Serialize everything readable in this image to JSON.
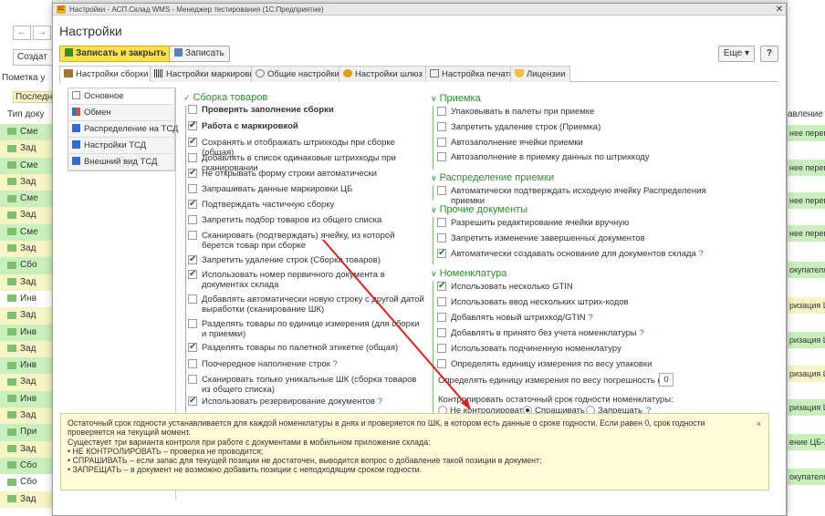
{
  "bg": {
    "create_label": "Создат",
    "mark_label": "Пометка у",
    "last_label": "Последн",
    "type_col": "Тип доку",
    "rows": [
      {
        "text": "Сме",
        "c": "g"
      },
      {
        "text": "Зад",
        "c": "y"
      },
      {
        "text": "Сме",
        "c": "g"
      },
      {
        "text": "Зад",
        "c": "y"
      },
      {
        "text": "Сме",
        "c": "g"
      },
      {
        "text": "Зад",
        "c": "y"
      },
      {
        "text": "Сме",
        "c": "g"
      },
      {
        "text": "Зад",
        "c": "y"
      },
      {
        "text": "Сбо",
        "c": "g"
      },
      {
        "text": "Зад",
        "c": "y"
      },
      {
        "text": "Инв",
        "c": "w"
      },
      {
        "text": "Зад",
        "c": "y"
      },
      {
        "text": "Инв",
        "c": "g"
      },
      {
        "text": "Зад",
        "c": "y"
      },
      {
        "text": "Инв",
        "c": "g"
      },
      {
        "text": "Зад",
        "c": "y"
      },
      {
        "text": "Инв",
        "c": "g"
      },
      {
        "text": "Зад",
        "c": "y"
      },
      {
        "text": "При",
        "c": "g"
      },
      {
        "text": "Зад",
        "c": "y"
      },
      {
        "text": "Сбо",
        "c": "g"
      },
      {
        "text": "Сбо",
        "c": "w"
      },
      {
        "text": "Зад",
        "c": "y"
      }
    ],
    "right_header": "авление",
    "right_rows": [
      "нее переме",
      "нее переме",
      "нее переме",
      "нее переме",
      "окупателя Ц",
      "ризация ЦБ",
      "ризация ЦБ",
      "ризация ЦБ",
      "ризация ЦБ",
      "ение ЦБ-2",
      "окупателя Ц"
    ]
  },
  "window": {
    "title": "Настройки - АСП.Склад WMS - Менеджер тестирования (1С:Предприятие)",
    "form_title": "Настройки"
  },
  "toolbar": {
    "save_close": "Записать и закрыть",
    "save": "Записать",
    "more": "Еще",
    "help": "?"
  },
  "tabs": [
    "Настройки сборки",
    "Настройки маркировки",
    "Общие настройки",
    "Настройки шлюз",
    "Настройка печати",
    "Лицензии"
  ],
  "sidebar": [
    "Основное",
    "Обмен",
    "Распределение на ТСД",
    "Настройки ТСД",
    "Внешний вид ТСД"
  ],
  "left": {
    "group": "Сборка товаров",
    "items": [
      {
        "text": "Проверять заполнение сборки",
        "checked": false,
        "bold": true
      },
      {
        "text": "Работа с маркировкой",
        "checked": true,
        "bold": true
      },
      {
        "text": "Сохранять  и отображать штрихкоды при сборке (общая)",
        "checked": true
      },
      {
        "text": "Добавлять в список одинаковые штрихкоды при сканировании",
        "checked": false
      },
      {
        "text": "Не открывать форму строки автоматически",
        "checked": true
      },
      {
        "text": "Запрашивать данные маркировки ЦБ",
        "checked": false
      },
      {
        "text": "Подтверждать частичную сборку",
        "checked": true
      },
      {
        "text": "Запретить подбор товаров из общего списка",
        "checked": false
      },
      {
        "text": "Сканировать (подтверждать) ячейку, из которой берется товар при сборке",
        "checked": false
      },
      {
        "text": "Запретить удаление строк (Сборка товаров)",
        "checked": true
      },
      {
        "text": "Использовать номер первичного документа в документах склада",
        "checked": true
      },
      {
        "text": "Добавлять автоматически новую строку с другой датой выработки (сканирование ШК)",
        "checked": false
      },
      {
        "text": "Разделять товары по единице измерения (для сборки и приемки)",
        "checked": false
      },
      {
        "text": "Разделять товары по палетной этикетке (общая)",
        "checked": true
      },
      {
        "text": "Поочередное наполнение строк",
        "checked": false,
        "q": "?"
      },
      {
        "text": "Сканировать только уникальные ШК (сборка товаров из общего списка)",
        "checked": false
      },
      {
        "text": "Использовать резервирование документов",
        "checked": true,
        "q": "?"
      }
    ]
  },
  "right": {
    "g1": "Приемка",
    "g1_items": [
      {
        "text": "Упаковывать в палеты при приемке",
        "checked": false
      },
      {
        "text": "Запретить удаление строк (Приемка)",
        "checked": false
      },
      {
        "text": "Автозаполнение ячейки приемки",
        "checked": false
      },
      {
        "text": "Автозаполнение в приемку данных по штрихкоду",
        "checked": false
      }
    ],
    "g2": "Распределение приемки",
    "g2_items": [
      {
        "text": "Автоматически подтверждать исходную ячейку Распределения приемки",
        "checked": false
      }
    ],
    "g3": "Прочие документы",
    "g3_items": [
      {
        "text": "Разрешить редактирование ячейки вручную",
        "checked": false
      },
      {
        "text": "Запретить изменение завершенных документов",
        "checked": false
      },
      {
        "text": "Автоматически создавать основание для документов склада",
        "checked": true,
        "q": "?"
      }
    ],
    "g4": "Номенклатура",
    "g4_items": [
      {
        "text": "Использовать несколько GTIN",
        "checked": true
      },
      {
        "text": "Использовать ввод нескольких штрих-кодов",
        "checked": false
      },
      {
        "text": "Добавлять новый штрихкод/GTIN",
        "checked": false,
        "q": "?"
      },
      {
        "text": "Добавлять в принято без учета номенклатуры",
        "checked": false,
        "q": "?"
      },
      {
        "text": "Использовать подчиненную номенклатуру",
        "checked": false
      },
      {
        "text": "Определять единицу измерения по весу упаковки",
        "checked": false
      }
    ],
    "weight_label": "Определять единицу измерения по весу погрешность (%):",
    "weight_value": "0",
    "shelf_label": "Контролировать остаточный срок годности номенклатуры:",
    "radio": [
      "Не контролировать",
      "Спрашивать",
      "Запрещать"
    ],
    "radio_selected": 1,
    "radio_q": "?"
  },
  "tooltip": {
    "line1": "Остаточный срок годности устанавливается для каждой номенклатуры в днях и проверяется по ШК, в котором есть данные о сроке годности. Если равен 0, срок годности проверяется на текущий момент.",
    "line2": "Существует три варианта контроля при работе с документами в мобильном приложение склада:",
    "line3": "• НЕ КОНТРОЛИРОВАТЬ – проверка не проводится;",
    "line4": "• СПРАШИВАТЬ – если запас для текущей позиции не достаточен, выводится вопрос о добавление такой позиции в документ;",
    "line5": "• ЗАПРЕЩАТЬ – в документ не возможно добавить позиции с неподходящим сроком годности.",
    "close": "×"
  },
  "colors": {
    "primary_btn": "#fce14d",
    "group_green": "#2f8f2f",
    "arrow": "#e0201a",
    "tooltip_bg": "#fdfbd8"
  }
}
